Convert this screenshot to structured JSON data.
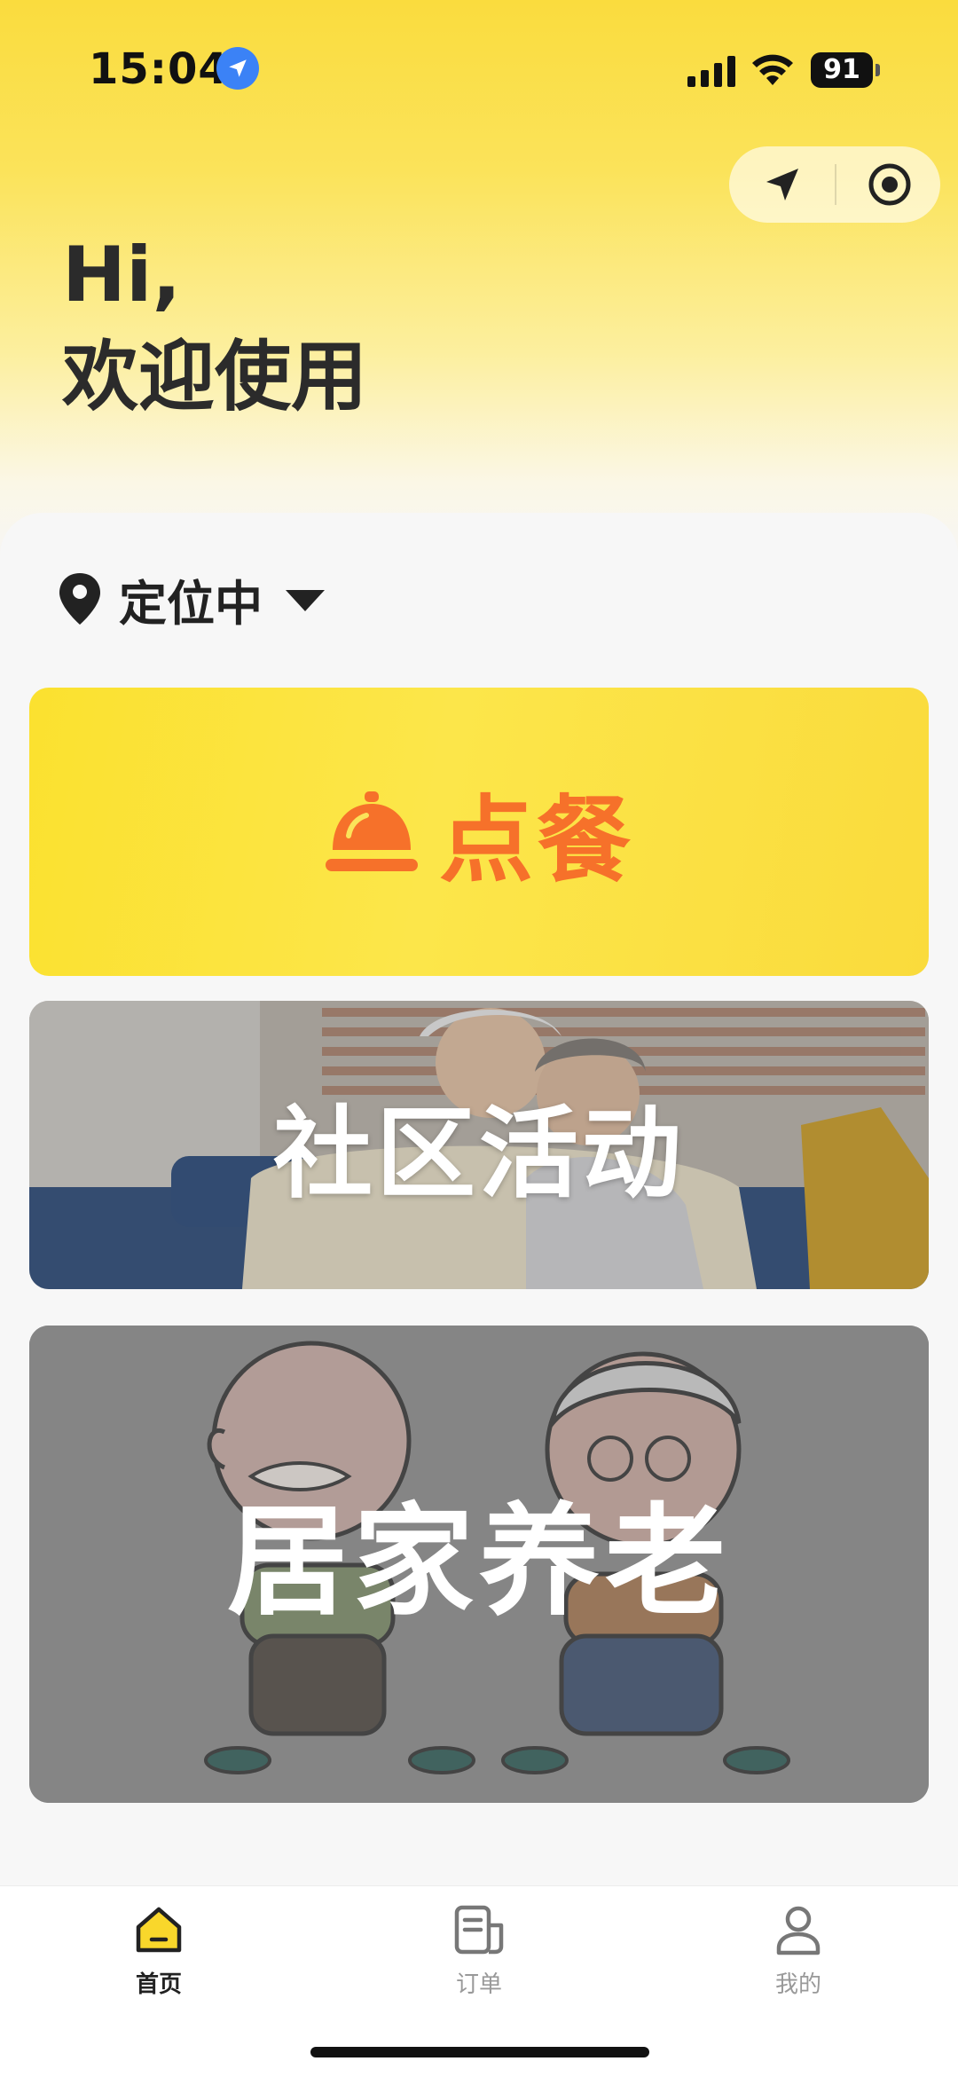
{
  "status_bar": {
    "time": "15:04",
    "battery": "91",
    "icons": [
      "location-arrow-icon",
      "signal-icon",
      "wifi-icon",
      "battery-icon"
    ]
  },
  "capsule": {
    "icons": [
      "navigation-icon",
      "target-icon"
    ]
  },
  "greeting": {
    "line1": "Hi,",
    "line2": "欢迎使用"
  },
  "location": {
    "label": "定位中",
    "icons": [
      "map-pin-icon",
      "caret-down-icon"
    ]
  },
  "cards": {
    "order": {
      "label": "点餐",
      "icon": "service-bell-icon",
      "color": "#f6712a"
    },
    "community": {
      "label": "社区活动"
    },
    "home_care": {
      "label": "居家养老"
    }
  },
  "tabbar": {
    "home": "首页",
    "orders": "订单",
    "mine": "我的",
    "active": "home"
  },
  "colors": {
    "brand_yellow": "#fadc3e",
    "accent_orange": "#f6712a",
    "tab_active_fill": "#f9d72b"
  }
}
